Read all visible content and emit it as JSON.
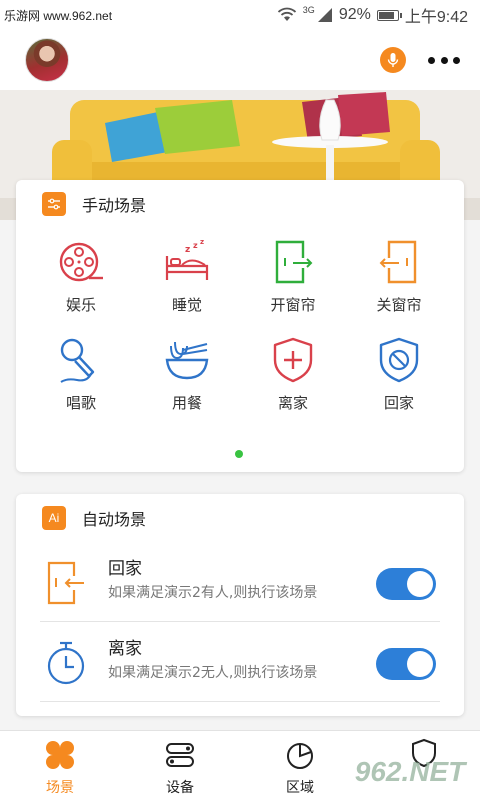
{
  "status_bar": {
    "watermark": "乐游网 www.962.net",
    "network_type": "3G",
    "battery": "92%",
    "battery_level": 0.92,
    "time": "上午9:42"
  },
  "colors": {
    "accent": "#f5891f",
    "toggle_on": "#2d7fd8",
    "page_dot": "#39c341",
    "icon_red": "#d9414b",
    "icon_green": "#2fae3b",
    "icon_orange": "#f0902c",
    "icon_blue": "#2f74c9"
  },
  "manual_scenes": {
    "title": "手动场景",
    "items": [
      {
        "label": "娱乐",
        "icon": "film-reel-icon"
      },
      {
        "label": "睡觉",
        "icon": "bed-icon"
      },
      {
        "label": "开窗帘",
        "icon": "curtain-open-icon"
      },
      {
        "label": "关窗帘",
        "icon": "curtain-close-icon"
      },
      {
        "label": "唱歌",
        "icon": "microphone-icon"
      },
      {
        "label": "用餐",
        "icon": "noodle-bowl-icon"
      },
      {
        "label": "离家",
        "icon": "shield-plus-icon"
      },
      {
        "label": "回家",
        "icon": "shield-block-icon"
      }
    ],
    "page_count": 1,
    "current_page": 1
  },
  "auto_scenes": {
    "title": "自动场景",
    "badge": "Ai",
    "items": [
      {
        "name": "回家",
        "description": "如果满足演示2有人,则执行该场景",
        "icon": "door-enter-icon",
        "enabled": true
      },
      {
        "name": "离家",
        "description": "如果满足演示2无人,则执行该场景",
        "icon": "timer-icon",
        "enabled": true
      }
    ]
  },
  "bottom_nav": {
    "items": [
      {
        "label": "场景",
        "icon": "clover-icon",
        "active": true
      },
      {
        "label": "设备",
        "icon": "device-toggle-icon",
        "active": false
      },
      {
        "label": "区域",
        "icon": "pie-region-icon",
        "active": false
      }
    ],
    "watermark": "962.NET"
  }
}
